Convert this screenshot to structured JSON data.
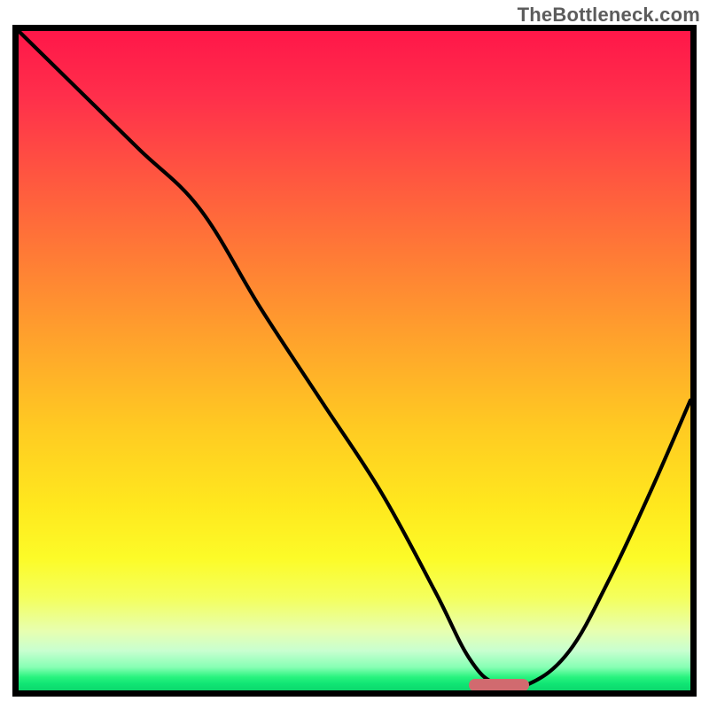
{
  "watermark": "TheBottleneck.com",
  "colors": {
    "frame": "#000000",
    "curve": "#000000",
    "marker": "#d16a6f",
    "gradient_top": "#ff1749",
    "gradient_bottom": "#0cd86d"
  },
  "chart_data": {
    "type": "line",
    "title": "",
    "xlabel": "",
    "ylabel": "",
    "xlim": [
      0,
      100
    ],
    "ylim": [
      0,
      100
    ],
    "grid": false,
    "curve": {
      "x": [
        0,
        9,
        18,
        27,
        36,
        45,
        54,
        62,
        67,
        71,
        76,
        82,
        88,
        94,
        100
      ],
      "y": [
        100,
        91,
        82,
        73,
        58,
        44,
        30,
        15,
        5,
        1,
        1,
        6,
        17,
        30,
        44
      ]
    },
    "marker": {
      "x_start": 67,
      "x_end": 76,
      "y": 0.8
    }
  }
}
